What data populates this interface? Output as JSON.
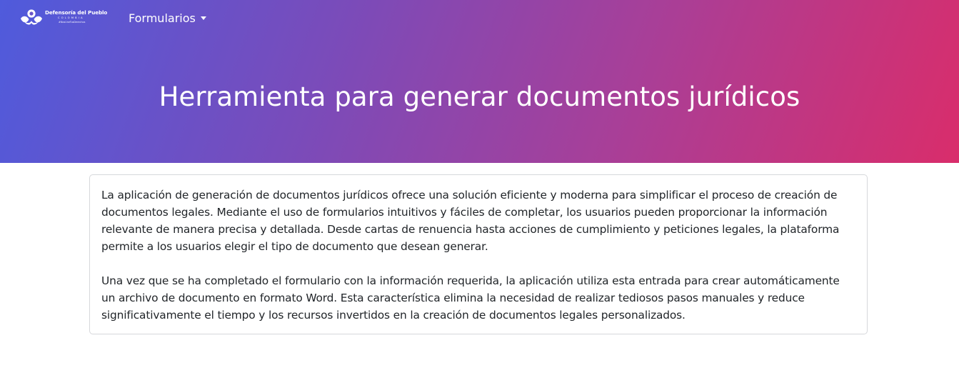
{
  "brand": {
    "name": "Defensoría del Pueblo",
    "country": "COLOMBIA",
    "tagline": "#NosUneTusDerechos"
  },
  "nav": {
    "dropdown_label": "Formularios",
    "dropdown_icon": "chevron-down-icon"
  },
  "hero": {
    "title": "Herramienta para generar documentos jurídicos",
    "gradient_colors": [
      "#4f5bdc",
      "#7b4bb9",
      "#a83f98",
      "#d92d6b"
    ]
  },
  "card": {
    "paragraphs": [
      "La aplicación de generación de documentos jurídicos ofrece una solución eficiente y moderna para simplificar el proceso de creación de documentos legales. Mediante el uso de formularios intuitivos y fáciles de completar, los usuarios pueden proporcionar la información relevante de manera precisa y detallada. Desde cartas de renuencia hasta acciones de cumplimiento y peticiones legales, la plataforma permite a los usuarios elegir el tipo de documento que desean generar.",
      "Una vez que se ha completado el formulario con la información requerida, la aplicación utiliza esta entrada para crear automáticamente un archivo de documento en formato Word. Esta característica elimina la necesidad de realizar tediosos pasos manuales y reduce significativamente el tiempo y los recursos invertidos en la creación de documentos legales personalizados."
    ]
  }
}
